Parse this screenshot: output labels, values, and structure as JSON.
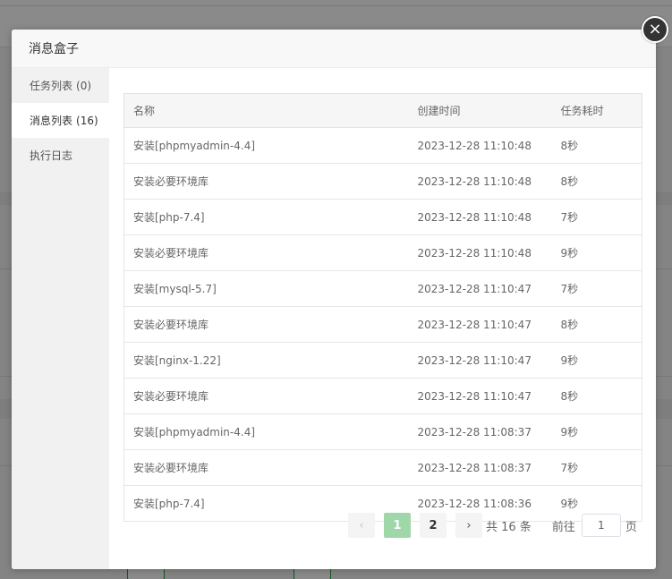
{
  "dialog": {
    "title": "消息盒子",
    "close_glyph": "×"
  },
  "sidebar": {
    "items": [
      {
        "label": "任务列表",
        "count": "(0)"
      },
      {
        "label": "消息列表",
        "count": "(16)"
      },
      {
        "label": "执行日志",
        "count": ""
      }
    ]
  },
  "table": {
    "headers": [
      "名称",
      "创建时间",
      "任务耗时"
    ],
    "rows": [
      [
        "安装[phpmyadmin-4.4]",
        "2023-12-28 11:10:48",
        "8秒"
      ],
      [
        "安装必要环境库",
        "2023-12-28 11:10:48",
        "8秒"
      ],
      [
        "安装[php-7.4]",
        "2023-12-28 11:10:48",
        "7秒"
      ],
      [
        "安装必要环境库",
        "2023-12-28 11:10:48",
        "9秒"
      ],
      [
        "安装[mysql-5.7]",
        "2023-12-28 11:10:47",
        "7秒"
      ],
      [
        "安装必要环境库",
        "2023-12-28 11:10:47",
        "8秒"
      ],
      [
        "安装[nginx-1.22]",
        "2023-12-28 11:10:47",
        "9秒"
      ],
      [
        "安装必要环境库",
        "2023-12-28 11:10:47",
        "8秒"
      ],
      [
        "安装[phpmyadmin-4.4]",
        "2023-12-28 11:08:37",
        "9秒"
      ],
      [
        "安装必要环境库",
        "2023-12-28 11:08:37",
        "7秒"
      ],
      [
        "安装[php-7.4]",
        "2023-12-28 11:08:36",
        "9秒"
      ]
    ]
  },
  "pagination": {
    "prev_glyph": "‹",
    "next_glyph": "›",
    "pages": [
      "1",
      "2"
    ],
    "total_text": "共 16 条",
    "goto_label": "前往",
    "goto_value": "1",
    "page_unit": "页"
  }
}
